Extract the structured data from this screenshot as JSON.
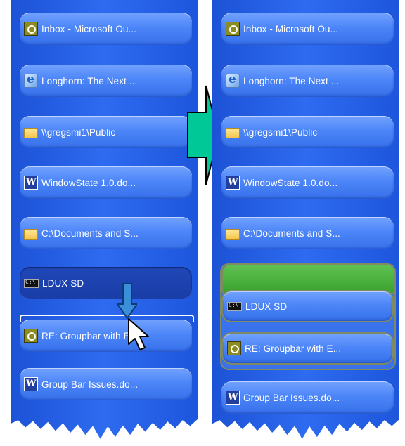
{
  "before_panel": {
    "items": [
      {
        "label": "Inbox - Microsoft Ou...",
        "icon": "outlook-icon"
      },
      {
        "label": "Longhorn: The Next ...",
        "icon": "ie-icon"
      },
      {
        "label": "\\\\gregsmi1\\Public",
        "icon": "folder-icon"
      },
      {
        "label": "WindowState 1.0.do...",
        "icon": "word-icon"
      },
      {
        "label": "C:\\Documents and S...",
        "icon": "folder-icon"
      },
      {
        "label": "LDUX SD",
        "icon": "cmd-icon",
        "state": "selected"
      },
      {
        "label": "RE: Groupbar with E...",
        "icon": "outlook-icon"
      },
      {
        "label": "Group Bar Issues.do...",
        "icon": "word-icon"
      }
    ],
    "drop_indicator": "white-insertion-line",
    "drag_arrow": "down-arrow-icon",
    "cursor": "mouse-pointer-icon"
  },
  "after_panel": {
    "items": [
      {
        "label": "Inbox - Microsoft Ou...",
        "icon": "outlook-icon"
      },
      {
        "label": "Longhorn: The Next ...",
        "icon": "ie-icon"
      },
      {
        "label": "\\\\gregsmi1\\Public",
        "icon": "folder-icon"
      },
      {
        "label": "WindowState 1.0.do...",
        "icon": "word-icon"
      }
    ],
    "item_after_folder": {
      "label": "C:\\Documents and S...",
      "icon": "folder-icon"
    },
    "group_header": "new-group-header",
    "group_items": [
      {
        "label": "LDUX SD",
        "icon": "cmd-icon"
      },
      {
        "label": "RE: Groupbar with E...",
        "icon": "outlook-icon"
      }
    ],
    "last_item": {
      "label": "Group Bar Issues.do...",
      "icon": "word-icon"
    }
  },
  "transition_arrow": "right-arrow-icon",
  "colors": {
    "taskbar_blue": "#2e6bf0",
    "button_blue": "#4d86f8",
    "selected_blue": "#1a3da6",
    "group_green": "#3aa22e",
    "group_border": "#7f8a62",
    "arrow_teal": "#00c896"
  }
}
